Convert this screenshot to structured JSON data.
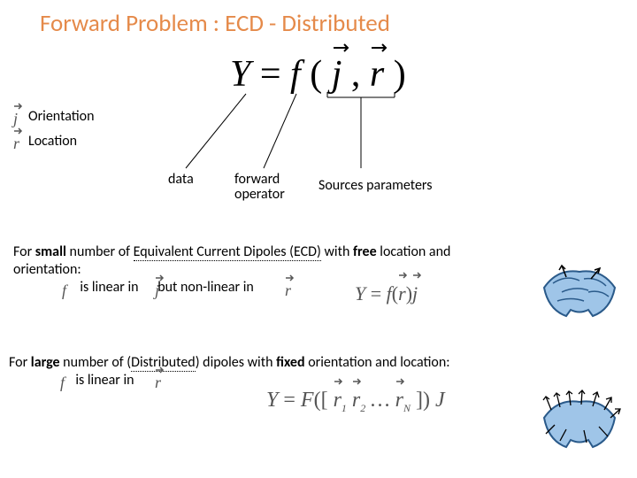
{
  "title": "Forward Problem : ECD - Distributed",
  "equation": {
    "Y": "Y",
    "eq": "=",
    "f": "f",
    "open": "(",
    "j": "j",
    "comma": ",",
    "r": "r",
    "close": ")"
  },
  "legend": {
    "orientation": "Orientation",
    "location": "Location",
    "data": "data",
    "forward": "forward",
    "operator": "operator",
    "sources": "Sources parameters"
  },
  "ecd": {
    "line1a": "For ",
    "small": "small",
    "line1b": " number of ",
    "ecd_full": "Equivalent Current Dipoles (ECD)",
    "line1c": " with ",
    "free": "free",
    "line1d": " location and",
    "line2": "orientation:",
    "indent_a": "     is linear in      but non-linear in",
    "f_sym": "f",
    "j_sym": "j",
    "r_sym": "r",
    "eq2_Y": "Y",
    "eq2_eq": " = ",
    "eq2_f": "f",
    "eq2_open": "(",
    "eq2_r": "r",
    "eq2_close": ")",
    "eq2_j": " j"
  },
  "dist": {
    "line1a": "For ",
    "large": "large",
    "line1b": " number of (",
    "distributed": "Distributed",
    "line1c": ") dipoles with ",
    "fixed": "fixed",
    "line1d": " orientation and location:",
    "indent": "     is linear in",
    "f_sym": "f",
    "r_sym": "r",
    "eq3_Y": "Y",
    "eq3_eq": " = ",
    "eq3_F": "F",
    "eq3_open": "([",
    "eq3_r1": "r",
    "eq3_s1": "1",
    "eq3_r2": "r",
    "eq3_s2": "2",
    "eq3_dots": "…",
    "eq3_rN": "r",
    "eq3_sN": "N",
    "eq3_close": "])",
    "eq3_J": "J"
  }
}
